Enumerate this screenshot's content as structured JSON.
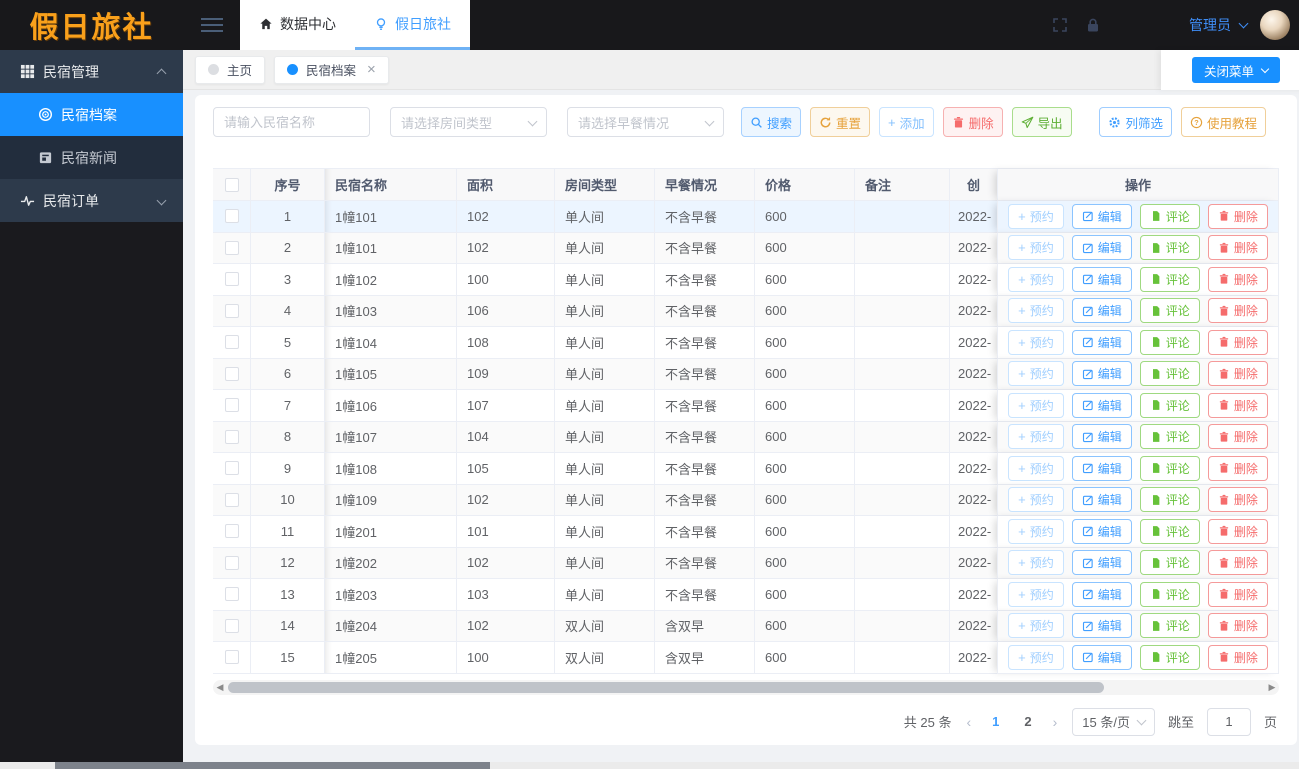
{
  "colors": {
    "primary": "#409eff",
    "sidebar_active": "#1890ff",
    "warning": "#e6a23c",
    "danger": "#f56c6c",
    "success": "#67c23a",
    "logo_orange": "#f9a01b",
    "topbar_bg": "#18181b",
    "hover_row_bg": "#ecf5ff"
  },
  "brand": {
    "logo_text": "假日旅社"
  },
  "header": {
    "tabs": [
      {
        "label": "数据中心",
        "icon": "home-icon",
        "active": false
      },
      {
        "label": "假日旅社",
        "icon": "bulb-icon",
        "active": true
      }
    ],
    "icons": [
      "fullscreen-icon",
      "lock-icon"
    ],
    "user_label": "管理员"
  },
  "sidebar": {
    "groups": [
      {
        "label": "民宿管理",
        "icon": "grid-icon",
        "expanded": true,
        "children": [
          {
            "label": "民宿档案",
            "icon": "archive-icon",
            "active": true
          },
          {
            "label": "民宿新闻",
            "icon": "news-icon",
            "active": false
          }
        ]
      },
      {
        "label": "民宿订单",
        "icon": "pulse-icon",
        "expanded": false,
        "children": []
      }
    ]
  },
  "tagsbar": {
    "tabs": [
      {
        "label": "主页",
        "active": false,
        "closable": false
      },
      {
        "label": "民宿档案",
        "active": true,
        "closable": true
      }
    ],
    "close_menu_label": "关闭菜单"
  },
  "filters": {
    "name_placeholder": "请输入民宿名称",
    "room_type_placeholder": "请选择房间类型",
    "breakfast_placeholder": "请选择早餐情况",
    "buttons": [
      {
        "label": "搜索",
        "icon": "search-icon"
      },
      {
        "label": "重置",
        "icon": "refresh-icon"
      },
      {
        "label": "添加",
        "icon": "plus-icon"
      },
      {
        "label": "删除",
        "icon": "trash-icon"
      },
      {
        "label": "导出",
        "icon": "send-icon"
      }
    ],
    "tools": [
      {
        "label": "列筛选",
        "icon": "gear-icon"
      },
      {
        "label": "使用教程",
        "icon": "question-icon"
      }
    ]
  },
  "table": {
    "columns": [
      "序号",
      "民宿名称",
      "面积",
      "房间类型",
      "早餐情况",
      "价格",
      "备注",
      "创",
      "操作"
    ],
    "row_actions": [
      {
        "label": "预约",
        "icon": "plus-icon"
      },
      {
        "label": "编辑",
        "icon": "edit-icon"
      },
      {
        "label": "评论",
        "icon": "document-icon"
      },
      {
        "label": "删除",
        "icon": "trash-icon"
      }
    ],
    "highlighted_row_no": 1,
    "rows": [
      {
        "no": 1,
        "name": "1幢101",
        "area": "102",
        "room_type": "单人间",
        "breakfast": "不含早餐",
        "price": "600",
        "remark": "",
        "created": "2022-"
      },
      {
        "no": 2,
        "name": "1幢101",
        "area": "102",
        "room_type": "单人间",
        "breakfast": "不含早餐",
        "price": "600",
        "remark": "",
        "created": "2022-"
      },
      {
        "no": 3,
        "name": "1幢102",
        "area": "100",
        "room_type": "单人间",
        "breakfast": "不含早餐",
        "price": "600",
        "remark": "",
        "created": "2022-"
      },
      {
        "no": 4,
        "name": "1幢103",
        "area": "106",
        "room_type": "单人间",
        "breakfast": "不含早餐",
        "price": "600",
        "remark": "",
        "created": "2022-"
      },
      {
        "no": 5,
        "name": "1幢104",
        "area": "108",
        "room_type": "单人间",
        "breakfast": "不含早餐",
        "price": "600",
        "remark": "",
        "created": "2022-"
      },
      {
        "no": 6,
        "name": "1幢105",
        "area": "109",
        "room_type": "单人间",
        "breakfast": "不含早餐",
        "price": "600",
        "remark": "",
        "created": "2022-"
      },
      {
        "no": 7,
        "name": "1幢106",
        "area": "107",
        "room_type": "单人间",
        "breakfast": "不含早餐",
        "price": "600",
        "remark": "",
        "created": "2022-"
      },
      {
        "no": 8,
        "name": "1幢107",
        "area": "104",
        "room_type": "单人间",
        "breakfast": "不含早餐",
        "price": "600",
        "remark": "",
        "created": "2022-"
      },
      {
        "no": 9,
        "name": "1幢108",
        "area": "105",
        "room_type": "单人间",
        "breakfast": "不含早餐",
        "price": "600",
        "remark": "",
        "created": "2022-"
      },
      {
        "no": 10,
        "name": "1幢109",
        "area": "102",
        "room_type": "单人间",
        "breakfast": "不含早餐",
        "price": "600",
        "remark": "",
        "created": "2022-"
      },
      {
        "no": 11,
        "name": "1幢201",
        "area": "101",
        "room_type": "单人间",
        "breakfast": "不含早餐",
        "price": "600",
        "remark": "",
        "created": "2022-"
      },
      {
        "no": 12,
        "name": "1幢202",
        "area": "102",
        "room_type": "单人间",
        "breakfast": "不含早餐",
        "price": "600",
        "remark": "",
        "created": "2022-"
      },
      {
        "no": 13,
        "name": "1幢203",
        "area": "103",
        "room_type": "单人间",
        "breakfast": "不含早餐",
        "price": "600",
        "remark": "",
        "created": "2022-"
      },
      {
        "no": 14,
        "name": "1幢204",
        "area": "102",
        "room_type": "双人间",
        "breakfast": "含双早",
        "price": "600",
        "remark": "",
        "created": "2022-"
      },
      {
        "no": 15,
        "name": "1幢205",
        "area": "100",
        "room_type": "双人间",
        "breakfast": "含双早",
        "price": "600",
        "remark": "",
        "created": "2022-"
      }
    ]
  },
  "pagination": {
    "total_label": "共 25 条",
    "prev_icon": "chevron-left-icon",
    "next_icon": "chevron-right-icon",
    "pages": [
      "1",
      "2"
    ],
    "current_page": "1",
    "page_size_label": "15 条/页",
    "jump_prefix": "跳至",
    "jump_value": "1",
    "jump_suffix": "页"
  }
}
